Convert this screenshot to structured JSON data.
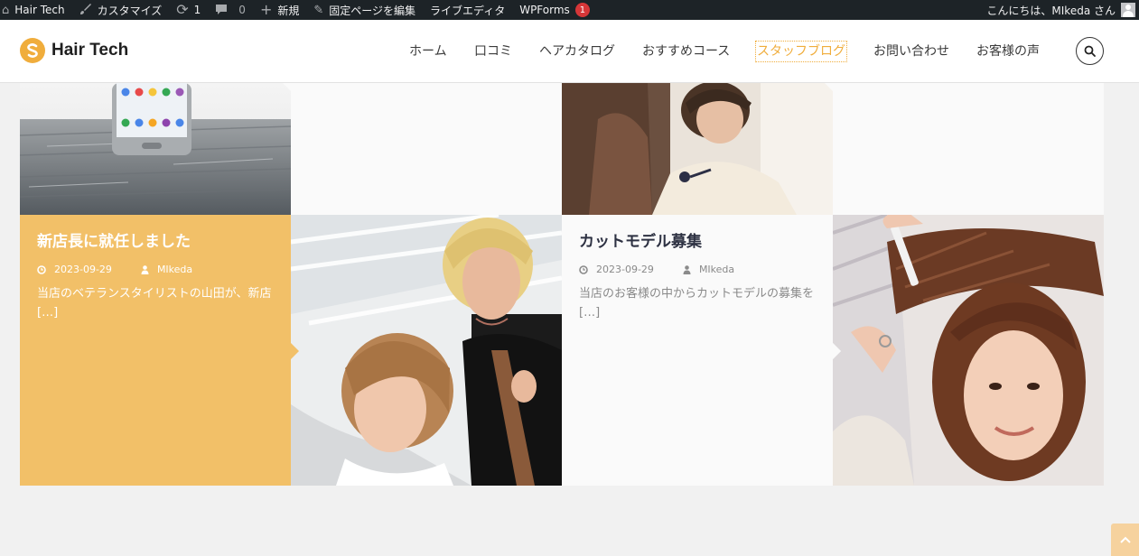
{
  "admin_bar": {
    "site_name": "Hair Tech",
    "customize": "カスタマイズ",
    "updates_count": "1",
    "comments_count": "0",
    "new": "新規",
    "edit_page": "固定ページを編集",
    "live_editor": "ライブエディタ",
    "wpforms": "WPForms",
    "wpforms_badge": "1",
    "greeting": "こんにちは、MIkeda さん"
  },
  "header": {
    "logo_text": "Hair Tech",
    "logo_color": "#f0ad3c",
    "nav": [
      "ホーム",
      "口コミ",
      "ヘアカタログ",
      "おすすめコース",
      "スタッフブログ",
      "お問い合わせ",
      "お客様の声"
    ],
    "active_nav": "スタッフブログ"
  },
  "posts": [
    {
      "title": "新店長に就任しました",
      "date": "2023-09-29",
      "author": "MIkeda",
      "excerpt": "当店のベテランスタイリストの山田が、新店 […]",
      "theme": "orange"
    },
    {
      "title": "カットモデル募集",
      "date": "2023-09-29",
      "author": "MIkeda",
      "excerpt": "当店のお客様の中からカットモデルの募集を […]",
      "theme": "grey"
    }
  ],
  "colors": {
    "accent": "#f0ad3c",
    "orange_card": "#f2c068",
    "grey_card": "#fafafa",
    "admin_bar": "#1d2327"
  }
}
